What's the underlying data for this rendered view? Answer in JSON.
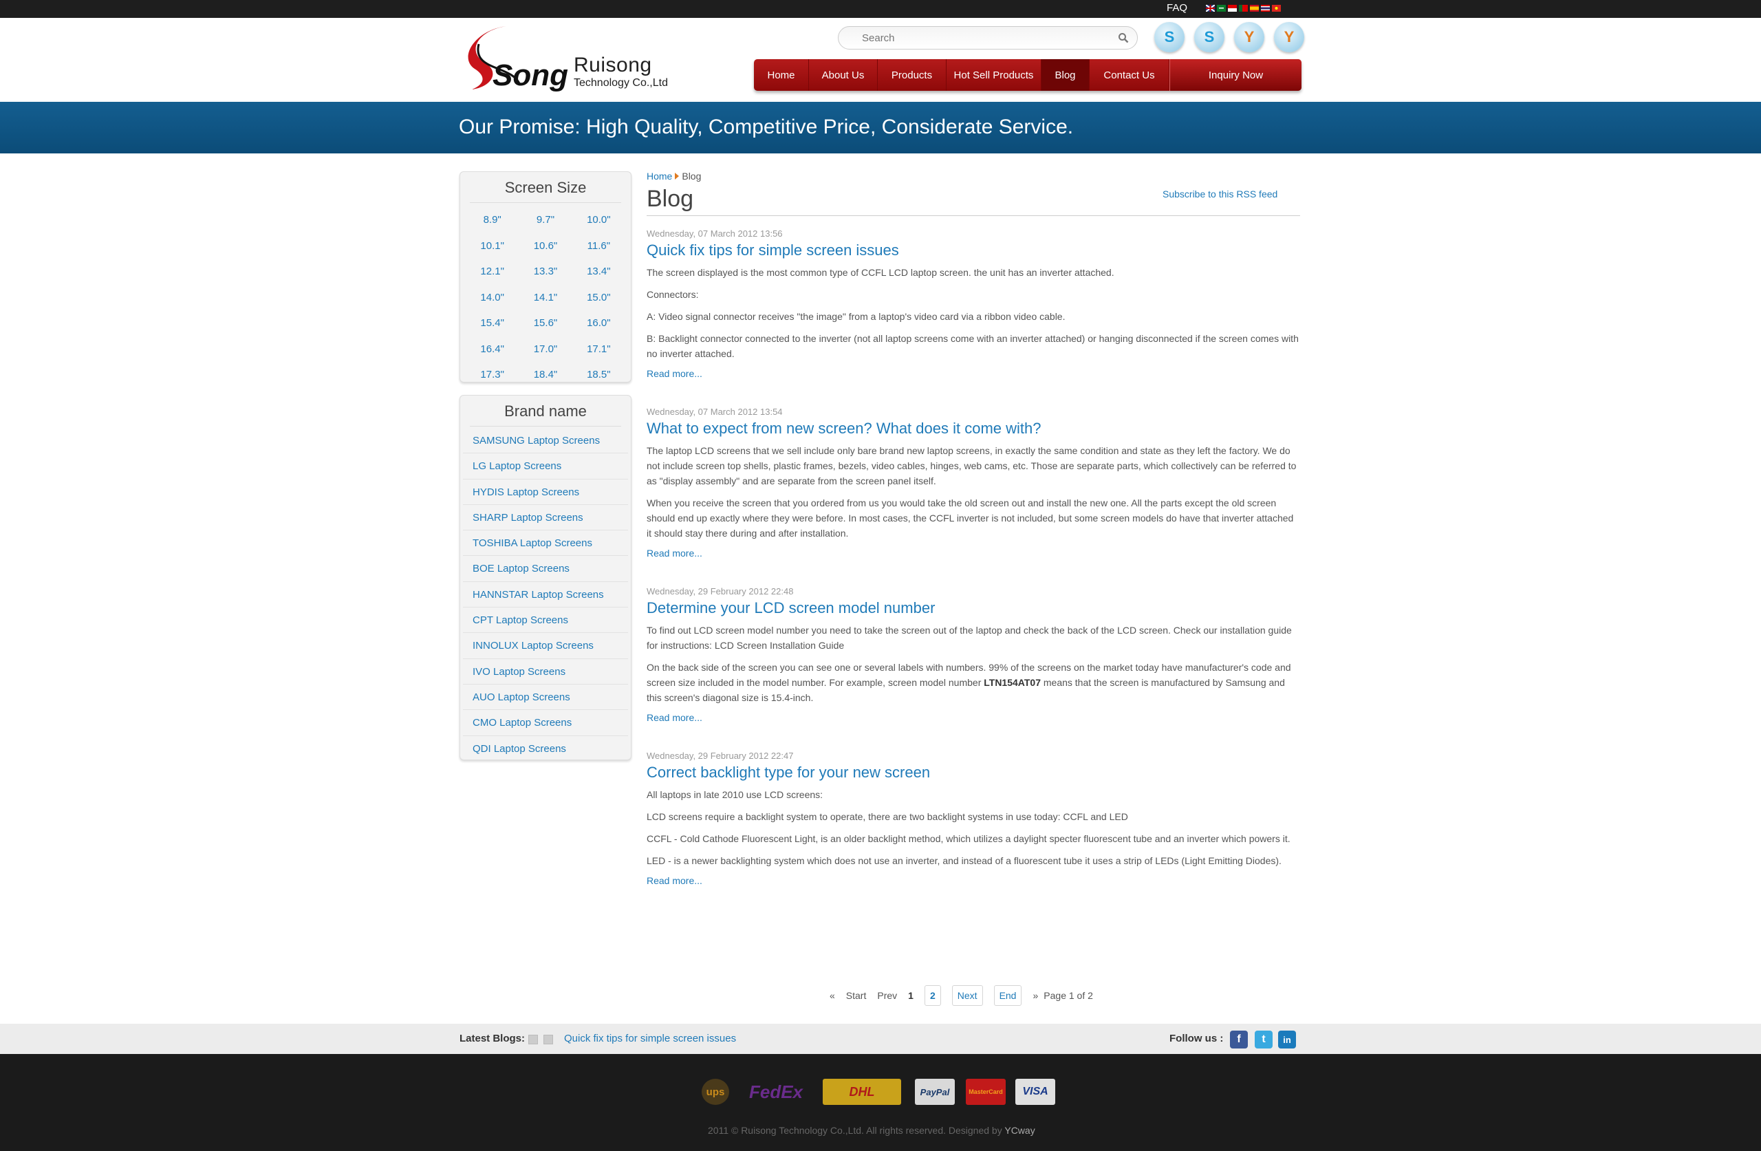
{
  "topbar": {
    "faq": "FAQ"
  },
  "logo": {
    "company": "Ruisong",
    "sub": "Technology Co.,Ltd",
    "mark": "Song"
  },
  "search": {
    "placeholder": "Search"
  },
  "nav": {
    "items": [
      "Home",
      "About Us",
      "Products",
      "Hot Sell Products",
      "Blog",
      "Contact Us"
    ],
    "inquiry": "Inquiry Now"
  },
  "banner": {
    "text": "Our Promise: High Quality, Competitive Price, Considerate Service."
  },
  "sidebar": {
    "size_title": "Screen Size",
    "sizes": [
      "8.9\"",
      "9.7\"",
      "10.0\"",
      "10.1\"",
      "10.6\"",
      "11.6\"",
      "12.1\"",
      "13.3\"",
      "13.4\"",
      "14.0\"",
      "14.1\"",
      "15.0\"",
      "15.4\"",
      "15.6\"",
      "16.0\"",
      "16.4\"",
      "17.0\"",
      "17.1\"",
      "17.3\"",
      "18.4\"",
      "18.5\""
    ],
    "brand_title": "Brand name",
    "brands": [
      "SAMSUNG Laptop Screens",
      "LG Laptop Screens",
      "HYDIS Laptop Screens",
      "SHARP Laptop Screens",
      "TOSHIBA Laptop Screens",
      "BOE Laptop Screens",
      "HANNSTAR Laptop Screens",
      "CPT Laptop Screens",
      "INNOLUX Laptop Screens",
      "IVO Laptop Screens",
      "AUO Laptop Screens",
      "CMO Laptop Screens",
      "QDI Laptop Screens"
    ]
  },
  "main": {
    "crumb_home": "Home",
    "crumb_current": "Blog",
    "rss": "Subscribe to this RSS feed",
    "title": "Blog",
    "read_more": "Read more...",
    "posts": [
      {
        "date": "Wednesday, 07 March 2012 13:56",
        "title": "Quick fix tips for simple screen issues",
        "p": [
          "The screen displayed is the most common type of CCFL LCD laptop screen. the unit has an inverter attached.",
          "Connectors:",
          "A: Video signal connector receives \"the image\" from a laptop's video card via a ribbon video cable.",
          "B: Backlight connector connected to the inverter (not all laptop screens come with an inverter attached) or hanging disconnected if the screen comes with no inverter attached."
        ]
      },
      {
        "date": "Wednesday, 07 March 2012 13:54",
        "title": "What to expect from new screen? What does it come with?",
        "p": [
          "The laptop LCD screens that we sell include only bare brand new laptop screens, in exactly the same condition and state as they left the factory. We do not include screen top shells, plastic frames, bezels, video cables, hinges, web cams, etc. Those are separate parts, which collectively can be referred to as \"display assembly\" and are separate from the screen panel itself.",
          "When you receive the screen that you ordered from us you would take the old screen out and install the new one. All the parts except the old screen should end up exactly where they were before. In most cases, the CCFL inverter is not included, but some screen models do have that inverter attached it should stay there during and after installation."
        ]
      },
      {
        "date": "Wednesday, 29 February 2012 22:48",
        "title": "Determine your LCD screen model number",
        "p": [
          "To find out LCD screen model number you need to take the screen out of the laptop and check the back of the LCD screen. Check our installation guide for instructions: LCD Screen Installation Guide"
        ],
        "p2_before": "On the back side of the screen you can see one or several labels with numbers. 99% of the screens on the market today have manufacturer's code and screen size included in the model number. For example, screen model number ",
        "p2_bold": "LTN154AT07",
        "p2_after": " means that the screen is manufactured by Samsung and this screen's diagonal size is 15.4-inch."
      },
      {
        "date": "Wednesday, 29 February 2012 22:47",
        "title": "Correct backlight type for your new screen",
        "p": [
          "All laptops in late 2010 use LCD screens:",
          "LCD screens require a backlight system to operate, there are two backlight systems in use today: CCFL and LED",
          "CCFL - Cold Cathode Fluorescent Light, is an older backlight method, which utilizes a daylight specter fluorescent tube and an inverter which powers it.",
          "LED - is a newer backlighting system which does not use an inverter, and instead of a fluorescent tube it uses a strip of LEDs (Light Emitting Diodes)."
        ]
      }
    ]
  },
  "pager": {
    "first": "«",
    "start": "Start",
    "prev": "Prev",
    "p1": "1",
    "p2": "2",
    "next": "Next",
    "end": "End",
    "last": "»",
    "info": "Page 1 of 2"
  },
  "latest": {
    "label": "Latest Blogs:",
    "link": "Quick fix tips for simple screen issues",
    "follow": "Follow us :"
  },
  "footer": {
    "payments": [
      "ups",
      "FedEx",
      "DHL",
      "PayPal",
      "MasterCard",
      "VISA"
    ],
    "copyright": "2011 © Ruisong Technology Co.,Ltd. All rights reserved.    Designed by",
    "designer": "YCway"
  }
}
